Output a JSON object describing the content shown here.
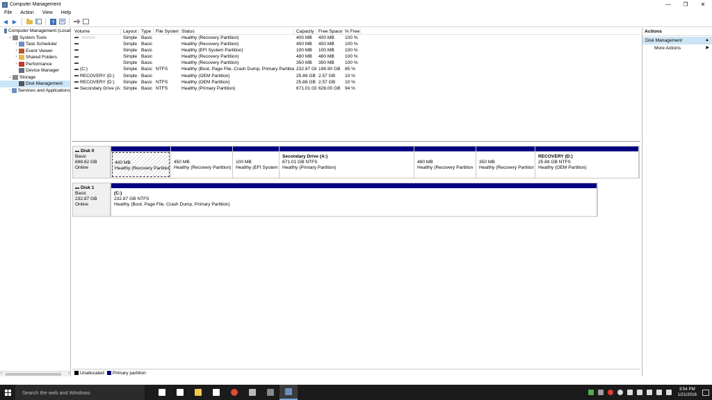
{
  "window": {
    "title": "Computer Management",
    "controls": [
      "—",
      "❐",
      "✕"
    ]
  },
  "menu": [
    "File",
    "Action",
    "View",
    "Help"
  ],
  "tree": [
    {
      "label": "Computer Management (Local",
      "level": 0,
      "exp": "",
      "icon": "computer-icon",
      "color": "#5b7da8"
    },
    {
      "label": "System Tools",
      "level": 1,
      "exp": "⌄",
      "icon": "tools-icon",
      "color": "#8a8a8a"
    },
    {
      "label": "Task Scheduler",
      "level": 2,
      "exp": "›",
      "icon": "clock-icon",
      "color": "#6b8fbf"
    },
    {
      "label": "Event Viewer",
      "level": 2,
      "exp": "›",
      "icon": "event-viewer-icon",
      "color": "#b5562d"
    },
    {
      "label": "Shared Folders",
      "level": 2,
      "exp": "›",
      "icon": "folder-icon",
      "color": "#e5b94a"
    },
    {
      "label": "Performance",
      "level": 2,
      "exp": "›",
      "icon": "performance-icon",
      "color": "#c0392b"
    },
    {
      "label": "Device Manager",
      "level": 2,
      "exp": "",
      "icon": "device-manager-icon",
      "color": "#607080"
    },
    {
      "label": "Storage",
      "level": 1,
      "exp": "⌄",
      "icon": "storage-icon",
      "color": "#8a8a8a"
    },
    {
      "label": "Disk Management",
      "level": 2,
      "exp": "",
      "icon": "disk-icon",
      "color": "#555",
      "selected": true
    },
    {
      "label": "Services and Applications",
      "level": 1,
      "exp": "›",
      "icon": "services-icon",
      "color": "#6b8fbf"
    }
  ],
  "volume_table": {
    "headers": [
      "Volume",
      "Layout",
      "Type",
      "File System",
      "Status",
      "Capacity",
      "Free Space",
      "% Free"
    ],
    "rows": [
      {
        "volume": "",
        "grey": true,
        "layout": "Simple",
        "type": "Basic",
        "fs": "",
        "status": "Healthy (Recovery Partition)",
        "capacity": "400 MB",
        "free": "400 MB",
        "pct": "100 %"
      },
      {
        "volume": "",
        "layout": "Simple",
        "type": "Basic",
        "fs": "",
        "status": "Healthy (Recovery Partition)",
        "capacity": "450 MB",
        "free": "450 MB",
        "pct": "100 %"
      },
      {
        "volume": "",
        "layout": "Simple",
        "type": "Basic",
        "fs": "",
        "status": "Healthy (EFI System Partition)",
        "capacity": "100 MB",
        "free": "100 MB",
        "pct": "100 %"
      },
      {
        "volume": "",
        "layout": "Simple",
        "type": "Basic",
        "fs": "",
        "status": "Healthy (Recovery Partition)",
        "capacity": "480 MB",
        "free": "480 MB",
        "pct": "100 %"
      },
      {
        "volume": "",
        "layout": "Simple",
        "type": "Basic",
        "fs": "",
        "status": "Healthy (Recovery Partition)",
        "capacity": "350 MB",
        "free": "350 MB",
        "pct": "100 %"
      },
      {
        "volume": "(C:)",
        "layout": "Simple",
        "type": "Basic",
        "fs": "NTFS",
        "status": "Healthy (Boot, Page File, Crash Dump, Primary Partition)",
        "capacity": "232.87 GB",
        "free": "196.90 GB",
        "pct": "85 %"
      },
      {
        "volume": "RECOVERY (D:)",
        "layout": "Simple",
        "type": "Basic",
        "fs": "",
        "status": "Healthy (OEM Partition)",
        "capacity": "25.88 GB",
        "free": "2.57 GB",
        "pct": "10 %"
      },
      {
        "volume": "RECOVERY (D:)",
        "layout": "Simple",
        "type": "Basic",
        "fs": "NTFS",
        "status": "Healthy (OEM Partition)",
        "capacity": "25.88 GB",
        "free": "2.57 GB",
        "pct": "10 %"
      },
      {
        "volume": "Secondary Drive (A:)",
        "layout": "Simple",
        "type": "Basic",
        "fs": "NTFS",
        "status": "Healthy (Primary Partition)",
        "capacity": "671.01 GB",
        "free": "628.00 GB",
        "pct": "94 %"
      }
    ]
  },
  "disks": [
    {
      "name": "Disk 0",
      "kind": "Basic",
      "size": "698.62 GB",
      "state": "Online",
      "partitions": [
        {
          "name": "",
          "line1": "400 MB",
          "line2": "Healthy (Recovery Partition",
          "selected": true
        },
        {
          "name": "",
          "line1": "450 MB",
          "line2": "Healthy (Recovery Partition)"
        },
        {
          "name": "",
          "line1": "100 MB",
          "line2": "Healthy (EFI System I"
        },
        {
          "name": "Secondary Drive  (A:)",
          "line1": "671.01 GB NTFS",
          "line2": "Healthy (Primary Partition)"
        },
        {
          "name": "",
          "line1": "480 MB",
          "line2": "Healthy (Recovery Partition"
        },
        {
          "name": "",
          "line1": "350 MB",
          "line2": "Healthy (Recovery Partition"
        },
        {
          "name": "RECOVERY  (D:)",
          "line1": "25.88 GB NTFS",
          "line2": "Healthy (OEM Partition)"
        }
      ]
    },
    {
      "name": "Disk 1",
      "kind": "Basic",
      "size": "232.87 GB",
      "state": "Online",
      "partitions": [
        {
          "name": "(C:)",
          "line1": "232.87 GB NTFS",
          "line2": "Healthy (Boot, Page File, Crash Dump, Primary Partition)"
        }
      ]
    }
  ],
  "legend": [
    {
      "label": "Unallocated",
      "color": "#000000"
    },
    {
      "label": "Primary partition",
      "color": "#000080"
    }
  ],
  "actions": {
    "header": "Actions",
    "section": "Disk Management",
    "items": [
      "More Actions"
    ]
  },
  "taskbar": {
    "search_placeholder": "Search the web and Windows",
    "apps": [
      {
        "icon": "task-view-icon",
        "color": "#ffffff"
      },
      {
        "icon": "settings-icon",
        "color": "#ffffff"
      },
      {
        "icon": "file-explorer-icon",
        "color": "#f2c94c"
      },
      {
        "icon": "store-icon",
        "color": "#ffffff"
      },
      {
        "icon": "chrome-icon",
        "color": "#e04a3a"
      },
      {
        "icon": "app-icon",
        "color": "#bbbbbb"
      },
      {
        "icon": "terminal-icon",
        "color": "#888888"
      },
      {
        "icon": "computer-management-icon",
        "color": "#6b8fbf",
        "active": true
      }
    ],
    "tray_icons": [
      {
        "icon": "tray-app-icon",
        "color": "#4caf50"
      },
      {
        "icon": "tray-shield-icon",
        "color": "#9e9e9e"
      },
      {
        "icon": "tray-record-icon",
        "color": "#e53935"
      },
      {
        "icon": "tray-circle-icon",
        "color": "#dddddd"
      },
      {
        "icon": "tray-clipboard-icon",
        "color": "#dddddd"
      },
      {
        "icon": "tray-network-icon",
        "color": "#dddddd"
      },
      {
        "icon": "tray-speaker-icon",
        "color": "#dddddd"
      },
      {
        "icon": "tray-monitor-icon",
        "color": "#dddddd"
      },
      {
        "icon": "tray-keyboard-icon",
        "color": "#dddddd"
      }
    ],
    "time": "3:54 PM",
    "date": "1/21/2016"
  }
}
